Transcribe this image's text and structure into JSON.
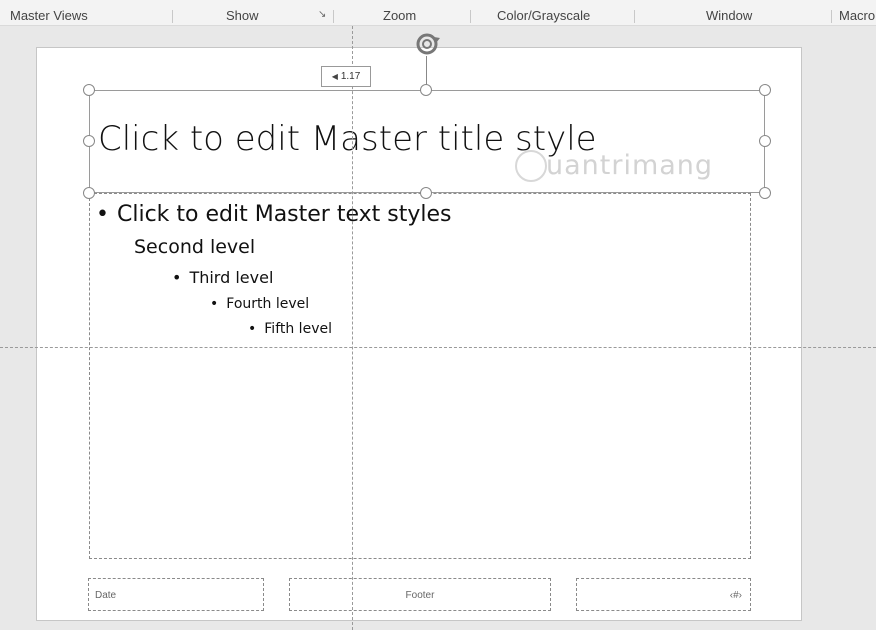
{
  "ribbon": {
    "groups": [
      "Master Views",
      "Show",
      "Zoom",
      "Color/Grayscale",
      "Window",
      "Macro"
    ],
    "show_launcher": "↘"
  },
  "slide": {
    "title": "Click to edit Master title style",
    "body": {
      "level1": "Click to edit Master text styles",
      "level2": "Second level",
      "level3": "Third level",
      "level4": "Fourth level",
      "level5": "Fifth level",
      "bullet": "•"
    },
    "date": "Date",
    "footer": "Footer",
    "number": "‹#›"
  },
  "tooltip": {
    "value": "1.17",
    "arrow_icon": "caret-left-icon"
  },
  "watermark": "uantrimang"
}
